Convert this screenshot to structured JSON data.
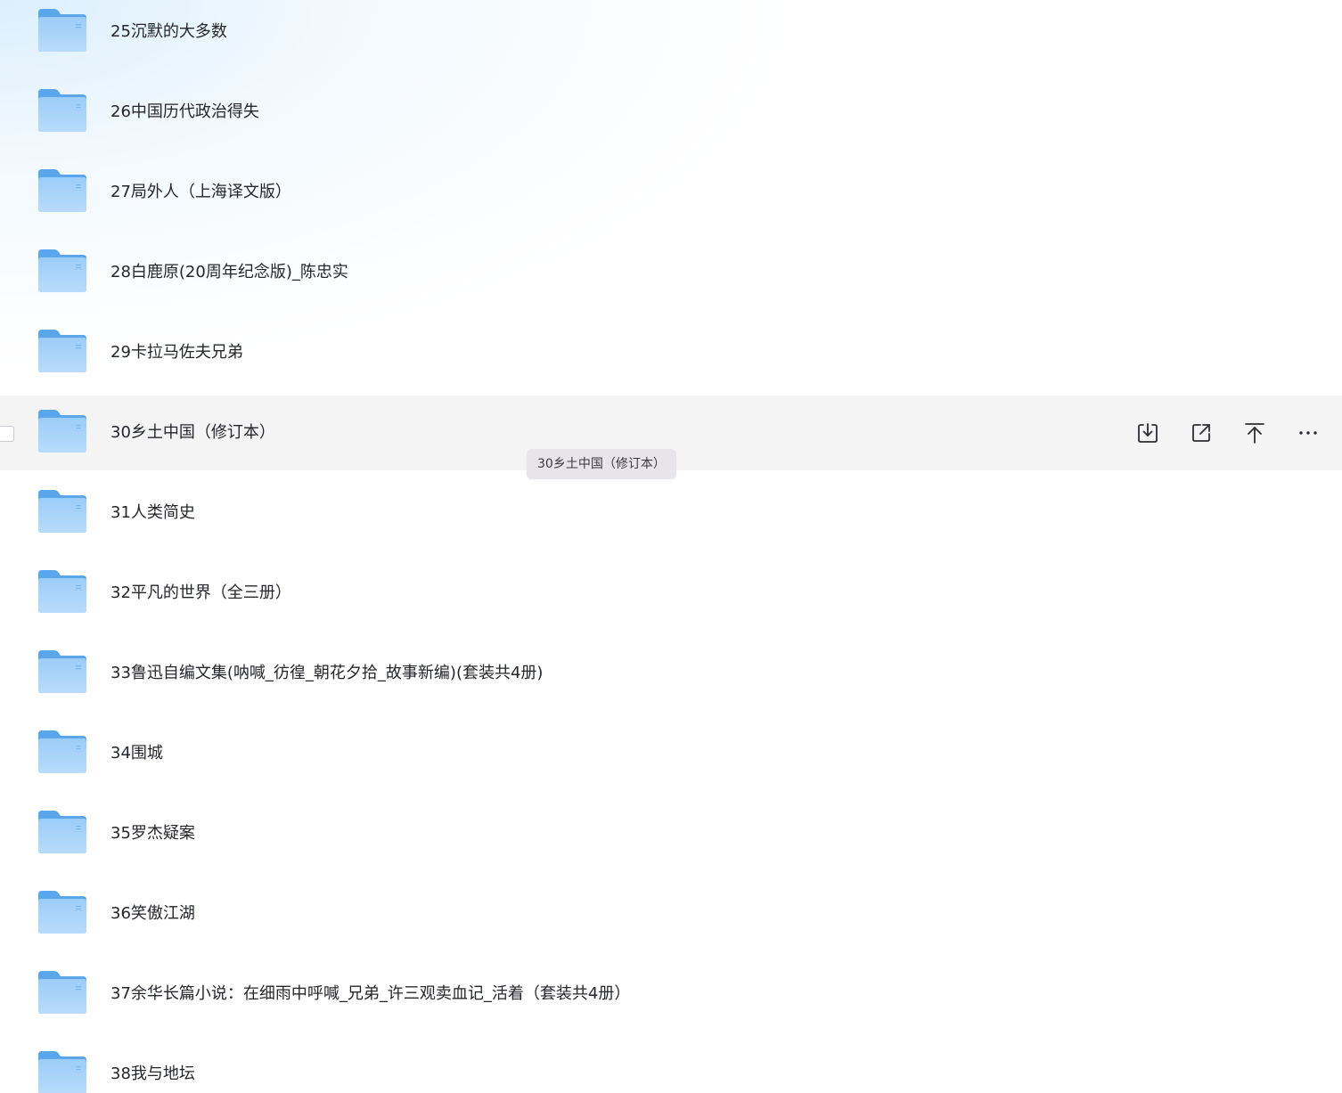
{
  "files": [
    {
      "name": "25沉默的大多数"
    },
    {
      "name": "26中国历代政治得失"
    },
    {
      "name": "27局外人（上海译文版）"
    },
    {
      "name": "28白鹿原(20周年纪念版)_陈忠实"
    },
    {
      "name": "29卡拉马佐夫兄弟"
    },
    {
      "name": "30乡土中国（修订本）"
    },
    {
      "name": "31人类简史"
    },
    {
      "name": "32平凡的世界（全三册）"
    },
    {
      "name": "33鲁迅自编文集(呐喊_彷徨_朝花夕拾_故事新编)(套装共4册)"
    },
    {
      "name": "34围城"
    },
    {
      "name": "35罗杰疑案"
    },
    {
      "name": "36笑傲江湖"
    },
    {
      "name": "37余华长篇小说：在细雨中呼喊_兄弟_许三观卖血记_活着（套装共4册）"
    },
    {
      "name": "38我与地坛"
    }
  ],
  "hovered_row_index": 5,
  "row_actions": [
    {
      "icon": "download-icon"
    },
    {
      "icon": "share-icon"
    },
    {
      "icon": "pin-top-icon"
    },
    {
      "icon": "more-icon"
    }
  ],
  "tooltip": {
    "text": "30乡土中国（修订本）"
  },
  "colors": {
    "folder_back": "#5aa6ec",
    "folder_front": "#a8d2fa",
    "hover_row_bg": "#f4f4f5",
    "tooltip_bg": "#e7e4ea",
    "text": "#25262b"
  }
}
